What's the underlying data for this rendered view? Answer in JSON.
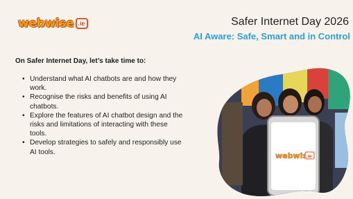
{
  "logo": {
    "word": "webwise",
    "badge": ".ie"
  },
  "header": {
    "title": "Safer Internet Day 2026",
    "subtitle": "AI Aware: Safe, Smart and in Control"
  },
  "intro": "On Safer Internet Day, let’s take time to:",
  "bullets": [
    {
      "line1": "Understand what AI chatbots are and how they",
      "line2": "work."
    },
    {
      "line1": "Recognise the risks and benefits of using AI",
      "line2": "chatbots."
    },
    {
      "line1": "Explore the features of AI chatbot design and the",
      "line2": "risks and limitations of interacting with these",
      "line3": "tools."
    },
    {
      "line1": "Develop strategies to safely and responsibly use",
      "line2": "AI tools."
    }
  ],
  "phone_logo": {
    "word": "webwise",
    "badge": ".ie"
  },
  "colors": {
    "accent_orange": "#f39a1e",
    "accent_blue": "#2f9fd8",
    "background": "#f7f3ec"
  }
}
